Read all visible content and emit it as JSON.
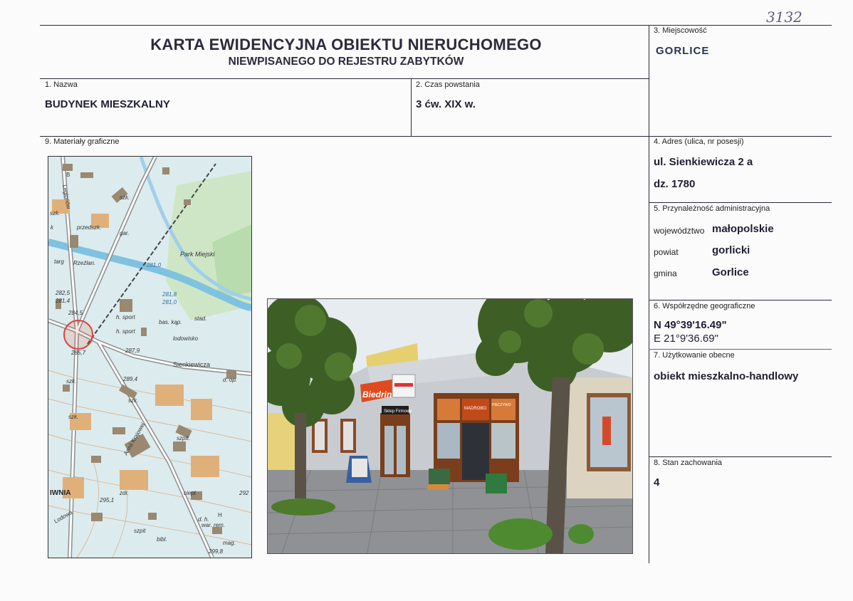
{
  "handwritten_number": "3132",
  "header": {
    "title_line1": "KARTA EWIDENCYJNA OBIEKTU NIERUCHOMEGO",
    "title_line2": "NIEWPISANEGO DO REJESTRU ZABYTKÓW"
  },
  "fields": {
    "miejscowosc": {
      "label": "3. Miejscowość",
      "value": "GORLICE"
    },
    "nazwa": {
      "label": "1. Nazwa",
      "value": "BUDYNEK MIESZKALNY"
    },
    "czas": {
      "label": "2. Czas powstania",
      "value": "3 ćw. XIX w."
    },
    "materialy": {
      "label": "9. Materiały graficzne"
    },
    "adres": {
      "label": "4. Adres (ulica, nr posesji)",
      "street": "ul. Sienkiewicza 2 a",
      "plot": "dz. 1780"
    },
    "przynaleznosc": {
      "label": "5. Przynależność administracyjna",
      "rows": [
        {
          "key": "województwo",
          "value": "małopolskie"
        },
        {
          "key": "powiat",
          "value": "gorlicki"
        },
        {
          "key": "gmina",
          "value": "Gorlice"
        }
      ]
    },
    "wspolrzedne": {
      "label": "6. Współrzędne geograficzne",
      "n": "N 49°39'16.49\"",
      "e": "E 21°9'36.69\""
    },
    "uzytkowanie": {
      "label": "7. Użytkowanie obecne",
      "value": "obiekt mieszkalno-handlowy"
    },
    "stan": {
      "label": "8. Stan zachowania",
      "value": "4"
    }
  },
  "map_labels": {
    "szk1": "szk.",
    "przedszk": "przedszk.",
    "gar": "gar.",
    "park": "Park Miejski",
    "targ": "targ",
    "rzeslan": "Rzeźlan.",
    "e281_0": "281,0",
    "e282_5": "282,5",
    "e281_4": "281,4",
    "e284_5": "284,5",
    "e281_8": "281,8",
    "e281_0b": "281,0",
    "hsport1": "h. sport",
    "hsport2": "h. sport",
    "baskap": "bas. kąp.",
    "stad": "stad.",
    "lodowisko": "lodowisko",
    "e285_7": "285,7",
    "e287_9": "287,9",
    "sienk": "Sienkiewicza",
    "szk2": "szk.",
    "dop": "d. op.",
    "e289_4": "289,4",
    "szk3": "szk.",
    "szk4": "szk.",
    "szpit": "szpit.",
    "krakowska": "Armii Krajowej",
    "iwnia": "IWNIA",
    "e295_1": "295,1",
    "lodowa": "Lodowa",
    "zdr": "zdr.",
    "ciepl": "ciepł.",
    "e292": "292",
    "szpit2": "szpit",
    "warrem": "war. rem.",
    "bibl": "bibl.",
    "mag": "mag.",
    "e299_8": "299,8",
    "dh": "d. h.",
    "h": "H",
    "ulg": "Legionów",
    "szk0": "szk.",
    "b": "B",
    "k": "k"
  },
  "photo_signs": {
    "brand": "Biedrinka",
    "shop": "Sklep Firmowy",
    "madrodo": "MADROBO",
    "pieczywo": "PIECZYWO"
  }
}
